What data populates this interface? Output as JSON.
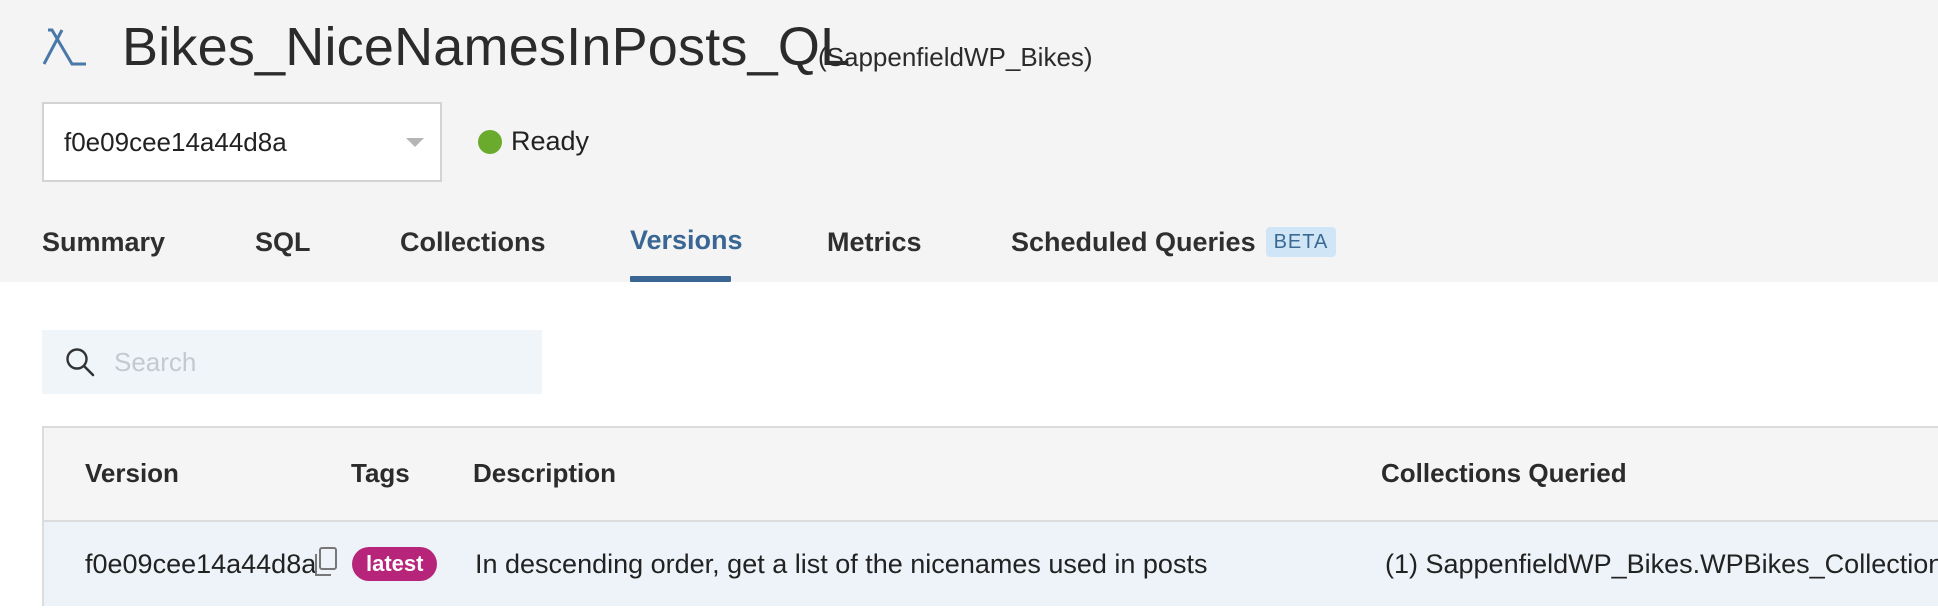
{
  "header": {
    "title": "Bikes_NiceNamesInPosts_QL",
    "workspace": "(SappenfieldWP_Bikes)",
    "icon": "lambda-icon",
    "version_selector": {
      "selected": "f0e09cee14a44d8a"
    },
    "status": {
      "label": "Ready",
      "color": "#6aab2e"
    }
  },
  "tabs": [
    {
      "label": "Summary",
      "active": false
    },
    {
      "label": "SQL",
      "active": false
    },
    {
      "label": "Collections",
      "active": false
    },
    {
      "label": "Versions",
      "active": true
    },
    {
      "label": "Metrics",
      "active": false
    },
    {
      "label": "Scheduled Queries",
      "active": false,
      "badge": "BETA"
    }
  ],
  "search": {
    "placeholder": "Search",
    "value": ""
  },
  "table": {
    "columns": [
      "Version",
      "Tags",
      "Description",
      "Collections Queried"
    ],
    "rows": [
      {
        "version": "f0e09cee14a44d8a",
        "tag": "latest",
        "description": "In descending order, get a list of the nicenames used in posts",
        "collections": "(1) SappenfieldWP_Bikes.WPBikes_Collection"
      }
    ]
  },
  "colors": {
    "accent": "#3a6694",
    "tag_latest": "#b6257a",
    "status_ready": "#6aab2e",
    "beta_badge_bg": "#d0e6f7"
  }
}
